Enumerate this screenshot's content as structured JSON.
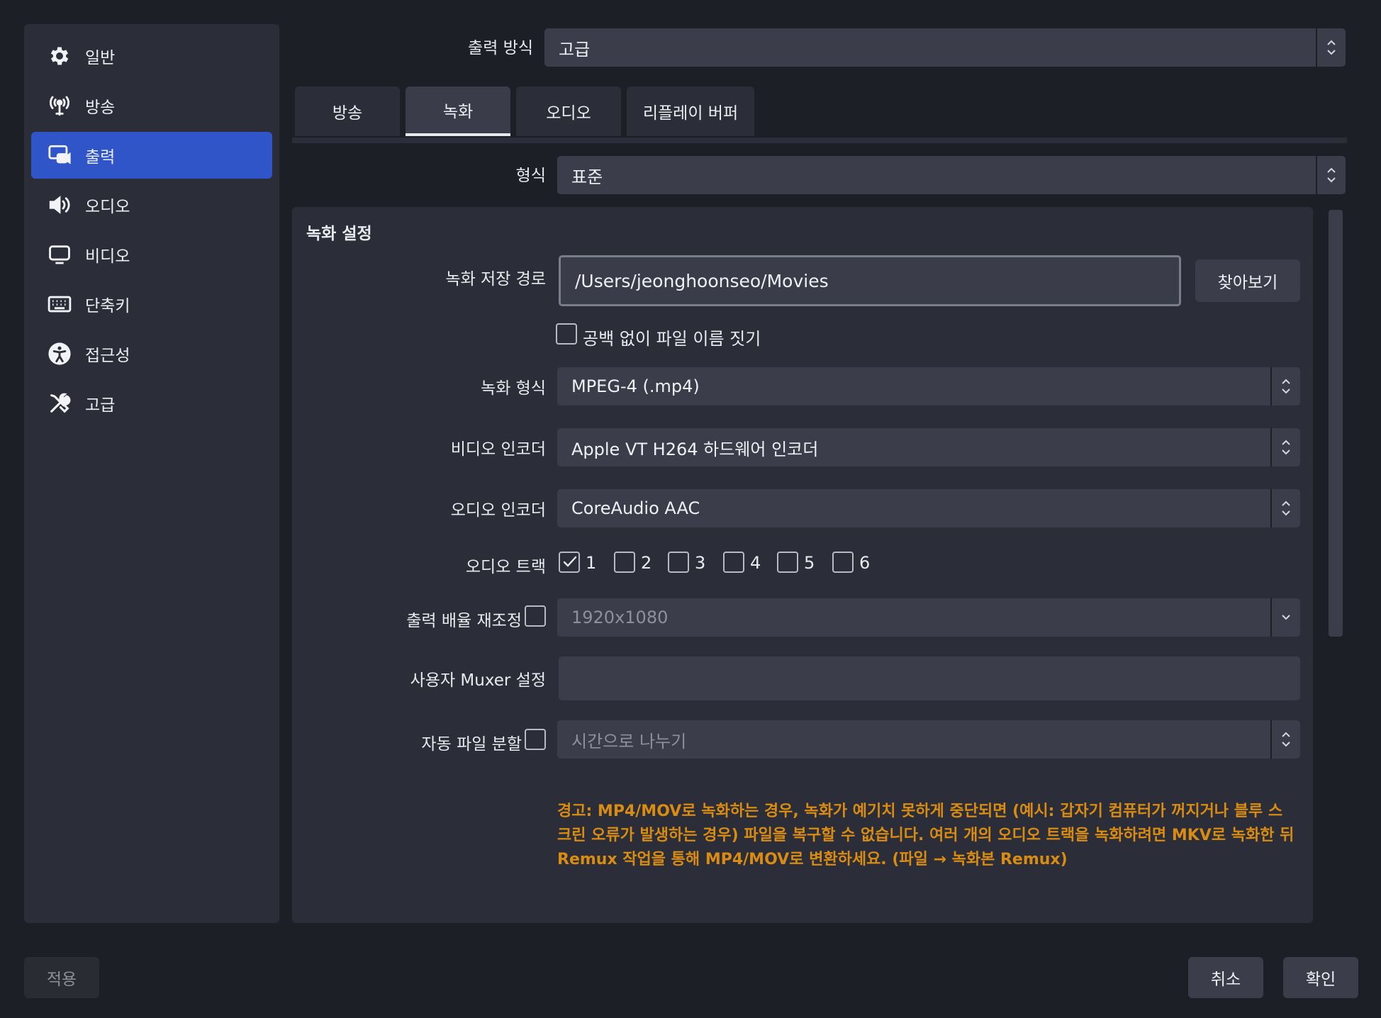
{
  "sidebar": {
    "items": [
      {
        "label": "일반",
        "icon": "gear-icon",
        "active": false
      },
      {
        "label": "방송",
        "icon": "broadcast-icon",
        "active": false
      },
      {
        "label": "출력",
        "icon": "output-icon",
        "active": true
      },
      {
        "label": "오디오",
        "icon": "speaker-icon",
        "active": false
      },
      {
        "label": "비디오",
        "icon": "monitor-icon",
        "active": false
      },
      {
        "label": "단축키",
        "icon": "keyboard-icon",
        "active": false
      },
      {
        "label": "접근성",
        "icon": "accessibility-icon",
        "active": false
      },
      {
        "label": "고급",
        "icon": "tools-icon",
        "active": false
      }
    ]
  },
  "output_mode": {
    "label": "출력 방식",
    "value": "고급"
  },
  "tabs": [
    {
      "label": "방송",
      "active": false
    },
    {
      "label": "녹화",
      "active": true
    },
    {
      "label": "오디오",
      "active": false
    },
    {
      "label": "리플레이 버퍼",
      "active": false
    }
  ],
  "format": {
    "label": "형식",
    "value": "표준"
  },
  "recording": {
    "section_title": "녹화 설정",
    "path_label": "녹화 저장 경로",
    "path_value": "/Users/jeonghoonseo/Movies",
    "browse_label": "찾아보기",
    "no_space_label": "공백 없이 파일 이름 짓기",
    "no_space_checked": false,
    "format_label": "녹화 형식",
    "format_value": "MPEG-4 (.mp4)",
    "video_encoder_label": "비디오 인코더",
    "video_encoder_value": "Apple VT H264 하드웨어 인코더",
    "audio_encoder_label": "오디오 인코더",
    "audio_encoder_value": "CoreAudio AAC",
    "audio_track_label": "오디오 트랙",
    "tracks": [
      {
        "label": "1",
        "checked": true
      },
      {
        "label": "2",
        "checked": false
      },
      {
        "label": "3",
        "checked": false
      },
      {
        "label": "4",
        "checked": false
      },
      {
        "label": "5",
        "checked": false
      },
      {
        "label": "6",
        "checked": false
      }
    ],
    "rescale_label": "출력 배율 재조정",
    "rescale_checked": false,
    "rescale_value": "1920x1080",
    "muxer_label": "사용자 Muxer 설정",
    "muxer_value": "",
    "split_label": "자동 파일 분할",
    "split_checked": false,
    "split_value": "시간으로 나누기",
    "warning": "경고: MP4/MOV로 녹화하는 경우, 녹화가 예기치 못하게 중단되면 (예시: 갑자기 컴퓨터가 꺼지거나 블루 스크린 오류가 발생하는 경우) 파일을 복구할 수 없습니다. 여러 개의 오디오 트랙을 녹화하려면 MKV로 녹화한 뒤 Remux 작업을 통해 MP4/MOV로 변환하세요. (파일 → 녹화본 Remux)"
  },
  "footer": {
    "apply": "적용",
    "cancel": "취소",
    "ok": "확인"
  },
  "colors": {
    "accent": "#2f55c9",
    "warning": "#d98b12",
    "panel": "#2b2e38",
    "background": "#1d1f27"
  }
}
